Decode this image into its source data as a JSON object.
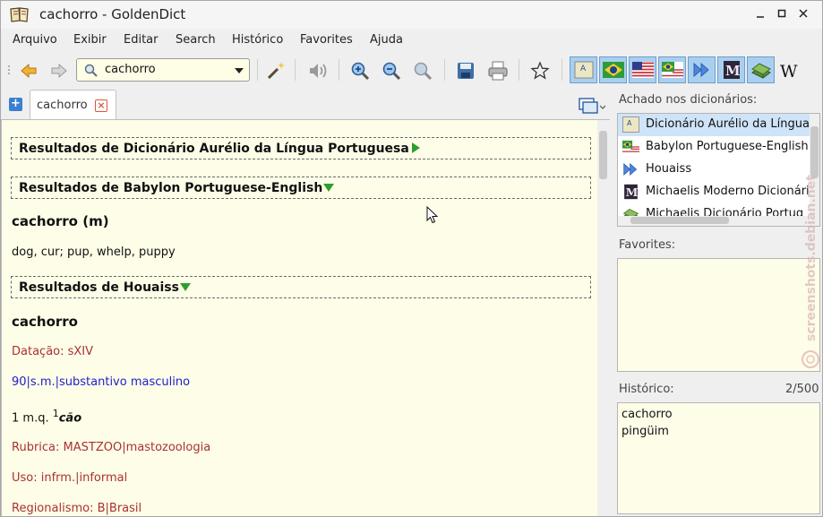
{
  "window": {
    "title": "cachorro - GoldenDict"
  },
  "menu": [
    "Arquivo",
    "Exibir",
    "Editar",
    "Search",
    "Histórico",
    "Favorites",
    "Ajuda"
  ],
  "search": {
    "value": "cachorro"
  },
  "tab": {
    "label": "cachorro"
  },
  "article": {
    "sections": [
      {
        "header": "Resultados de Dicionário Aurélio da Língua Portuguesa"
      },
      {
        "header": "Resultados de Babylon Portuguese-English"
      },
      {
        "header": "Resultados de Houaiss"
      }
    ],
    "babylon": {
      "headword": "cachorro (m)",
      "translation": "dog, cur; pup, whelp, puppy"
    },
    "houaiss": {
      "headword": "cachorro",
      "datacao": "Datação: sXIV",
      "grammar": "90|s.m.|substantivo masculino",
      "sense_prefix": "1 m.q. ",
      "sense_sup": "1",
      "sense_word": "cão",
      "rubrica": "Rubrica: MASTZOO|mastozoologia",
      "uso": "Uso: infrm.|informal",
      "regionalismo": "Regionalismo: B|Brasil"
    }
  },
  "sidebar": {
    "found_label": "Achado nos dicionários:",
    "found": [
      "Dicionário Aurélio da Língua",
      "Babylon Portuguese-English",
      "Houaiss",
      "Michaelis Moderno Dicionário",
      "Michaelis Dicionário Portug"
    ],
    "favorites_label": "Favorites:",
    "history_label": "Histórico:",
    "history_count": "2/500",
    "history": [
      "cachorro",
      "pingüim"
    ]
  },
  "watermark": "screenshots.debian.net",
  "colors": {
    "accent": "#a9cff0",
    "article_bg": "#fefde8",
    "green_arrow": "#2f9e2f",
    "red_text": "#a83232",
    "blue_text": "#1e1ec8"
  }
}
